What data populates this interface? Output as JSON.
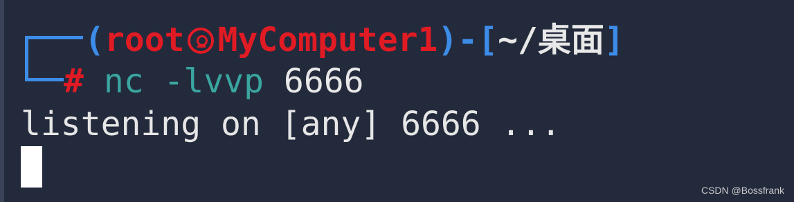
{
  "prompt": {
    "open_paren": "(",
    "user": "root",
    "skull_icon": "kali-skull-icon",
    "host": "MyComputer1",
    "close_paren": ")",
    "dash": "-",
    "open_bracket": "[",
    "path": "~/桌面",
    "close_bracket": "]",
    "hash": "#"
  },
  "command": {
    "name": "nc",
    "args": "-lvvp",
    "port": "6666"
  },
  "output": {
    "line": "listening on [any] 6666 ..."
  },
  "watermark": "CSDN @Bossfrank",
  "colors": {
    "background": "#232a3c",
    "prompt_blue": "#3d8ce8",
    "prompt_red": "#e01b24",
    "command_teal": "#3aa6a0",
    "text": "#e8e8e8"
  }
}
